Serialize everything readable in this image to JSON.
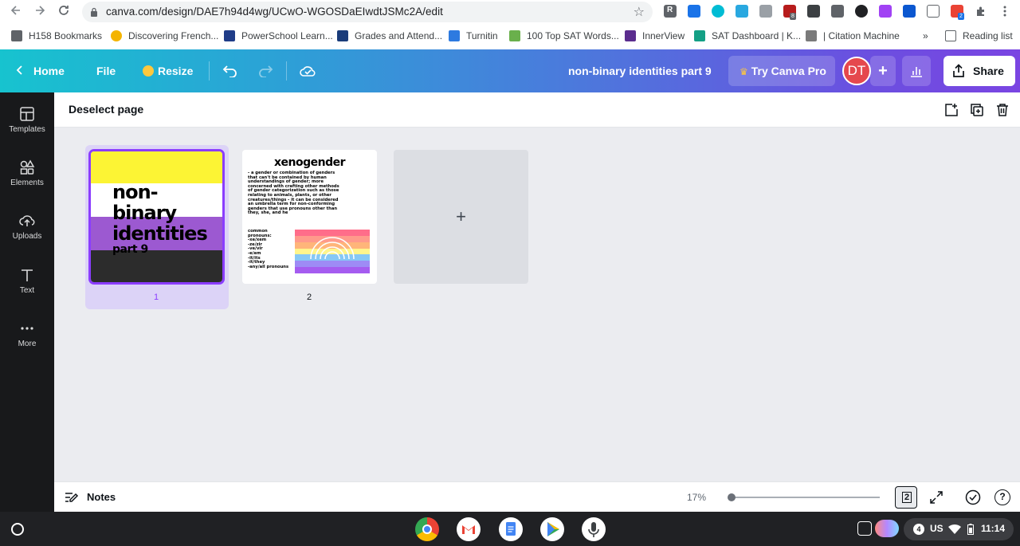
{
  "browser": {
    "url": "canva.com/design/DAE7h94d4wg/UCwO-WGOSDaEIwdtJSMc2A/edit",
    "bookmarks": [
      {
        "label": "H158 Bookmarks",
        "color": "#5f6368"
      },
      {
        "label": "Discovering French...",
        "color": "#f4b400"
      },
      {
        "label": "PowerSchool Learn...",
        "color": "#1f3c88"
      },
      {
        "label": "Grades and Attend...",
        "color": "#1a3c7a"
      },
      {
        "label": "Turnitin",
        "color": "#2d7ae0"
      },
      {
        "label": "100 Top SAT Words...",
        "color": "#6ab04c"
      },
      {
        "label": "InnerView",
        "color": "#5b2d8e"
      },
      {
        "label": "SAT Dashboard | K...",
        "color": "#14a085"
      },
      {
        "label": "| Citation Machine",
        "color": "#7a7a7a"
      }
    ],
    "more_bookmarks": "»",
    "reading_list": "Reading list",
    "ext_badges": {
      "a": "8",
      "b": "2"
    }
  },
  "header": {
    "home": "Home",
    "file": "File",
    "resize": "Resize",
    "design_title": "non-binary identities part 9",
    "try_pro": "Try Canva Pro",
    "avatar_initials": "DT",
    "share": "Share"
  },
  "sidebar": {
    "items": [
      {
        "label": "Templates",
        "icon": "templates-icon"
      },
      {
        "label": "Elements",
        "icon": "elements-icon"
      },
      {
        "label": "Uploads",
        "icon": "uploads-icon"
      },
      {
        "label": "Text",
        "icon": "text-icon"
      },
      {
        "label": "More",
        "icon": "more-icon"
      }
    ]
  },
  "toolbar": {
    "deselect": "Deselect page"
  },
  "pages": {
    "page1": {
      "number": "1",
      "lines": [
        "non-",
        "binary",
        "identities",
        "part 9"
      ],
      "stripe_colors": [
        "#fcf434",
        "#ffffff",
        "#9c59d1",
        "#2c2c2c"
      ]
    },
    "page2": {
      "number": "2",
      "title": "xenogender",
      "body": "- a gender or combination of genders that can't be contained by human understandings of gender; more concerned with crafting other methods of gender categorization such as those relating to animals, plants, or other creatures/things - it can be considered an umbrella term for non-conforming genders that use pronouns other than they, she, and he",
      "pronouns": [
        "common",
        "pronouns:",
        "-xe/xem",
        "-ze/zir",
        "-ve/vir",
        "-e/em",
        "-it/its",
        "-it/they",
        "-any/all pronouns"
      ]
    },
    "add_symbol": "+"
  },
  "bottom": {
    "notes": "Notes",
    "zoom": "17%",
    "zoom_fraction": 0.0,
    "pages_count": "2",
    "help": "?"
  },
  "shelf": {
    "status_count": "4",
    "keyboard": "US",
    "time": "11:14"
  }
}
